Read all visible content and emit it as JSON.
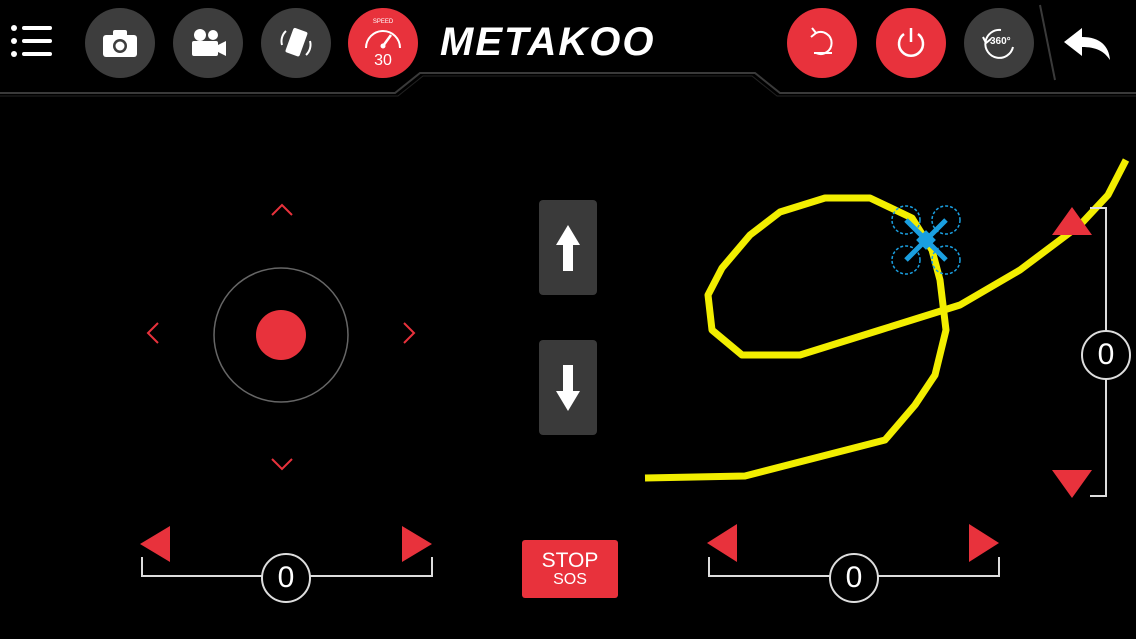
{
  "header": {
    "logo_text": "METAKOO",
    "speed_label": "SPEED",
    "speed_value": "30",
    "rotate_360_label": "360°"
  },
  "colors": {
    "accent": "#e8323c",
    "button_gray": "#3d3d3d",
    "flight_path": "#f2ee00",
    "drone": "#1a9fe0"
  },
  "icons": {
    "menu": "menu-icon",
    "camera": "camera-icon",
    "video": "video-camera-icon",
    "gravity": "phone-rotate-icon",
    "speed": "speedometer-icon",
    "return": "return-home-icon",
    "power": "power-icon",
    "rotate": "rotate-360-icon",
    "back": "back-arrow-icon"
  },
  "controls": {
    "left_trim_value": "0",
    "right_trim_value": "0",
    "vertical_trim_value": "0",
    "stop_label": "STOP",
    "sos_label": "SOS"
  }
}
